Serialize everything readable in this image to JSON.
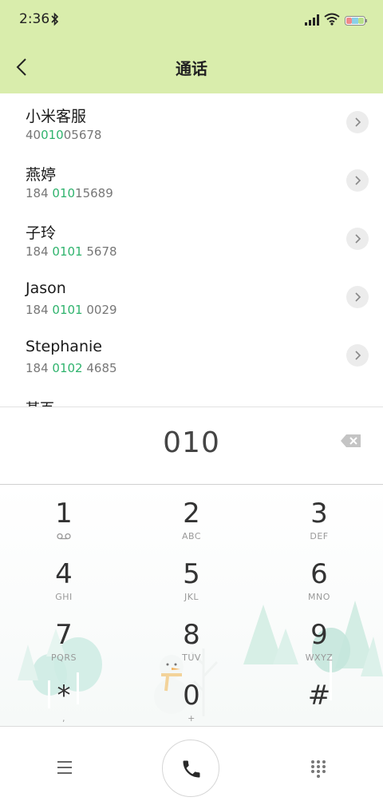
{
  "status_bar": {
    "time": "2:36",
    "icons": [
      "bluetooth-icon",
      "signal-icon",
      "wifi-icon",
      "battery-icon"
    ]
  },
  "header": {
    "title": "通话",
    "background_color": "#d9edac"
  },
  "contacts": [
    {
      "name": "小米客服",
      "number_before": "40",
      "number_match": "010",
      "number_after": "05678"
    },
    {
      "name": "燕婷",
      "number_before": "184 ",
      "number_match": "010",
      "number_after": "15689"
    },
    {
      "name": "子玲",
      "number_before": "184 ",
      "number_match": "0101",
      "number_after": " 5678"
    },
    {
      "name": "Jason",
      "number_before": "184 ",
      "number_match": "0101",
      "number_after": " 0029"
    },
    {
      "name": "Stephanie",
      "number_before": "184 ",
      "number_match": "0102",
      "number_after": " 4685"
    }
  ],
  "partial_contact": "某百",
  "dial": {
    "number": "010"
  },
  "keypad": {
    "keys": [
      {
        "digit": "1",
        "letters": ""
      },
      {
        "digit": "2",
        "letters": "ABC"
      },
      {
        "digit": "3",
        "letters": "DEF"
      },
      {
        "digit": "4",
        "letters": "GHI"
      },
      {
        "digit": "5",
        "letters": "JKL"
      },
      {
        "digit": "6",
        "letters": "MNO"
      },
      {
        "digit": "7",
        "letters": "PQRS"
      },
      {
        "digit": "8",
        "letters": "TUV"
      },
      {
        "digit": "9",
        "letters": "WXYZ"
      },
      {
        "digit": "*",
        "letters": ","
      },
      {
        "digit": "0",
        "letters": "+"
      },
      {
        "digit": "#",
        "letters": ""
      }
    ]
  },
  "colors": {
    "match_highlight": "#2fb36d",
    "header": "#d9edac"
  }
}
